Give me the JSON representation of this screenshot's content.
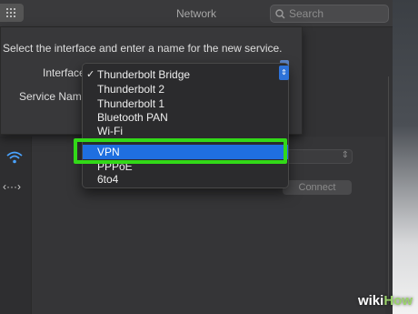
{
  "window": {
    "title": "Network"
  },
  "search": {
    "placeholder": "Search",
    "icon": "search-icon"
  },
  "sheet": {
    "instruction": "Select the interface and enter a name for the new service.",
    "interface_label": "Interface",
    "service_name_label": "Service Name"
  },
  "interface_menu": {
    "items": [
      {
        "label": "Thunderbolt Bridge",
        "checked": true
      },
      {
        "label": "Thunderbolt 2"
      },
      {
        "label": "Thunderbolt 1"
      },
      {
        "label": "Bluetooth PAN"
      },
      {
        "label": "Wi-Fi"
      },
      {
        "label": "VPN",
        "selected": true
      },
      {
        "label": "PPPoE"
      },
      {
        "label": "6to4"
      }
    ],
    "checkmark": "✓"
  },
  "background": {
    "connect_label": "Connect"
  },
  "highlight_color": "#32d918",
  "selection_color": "#1f6fe0",
  "watermark": {
    "prefix": "wiki",
    "suffix": "How"
  }
}
